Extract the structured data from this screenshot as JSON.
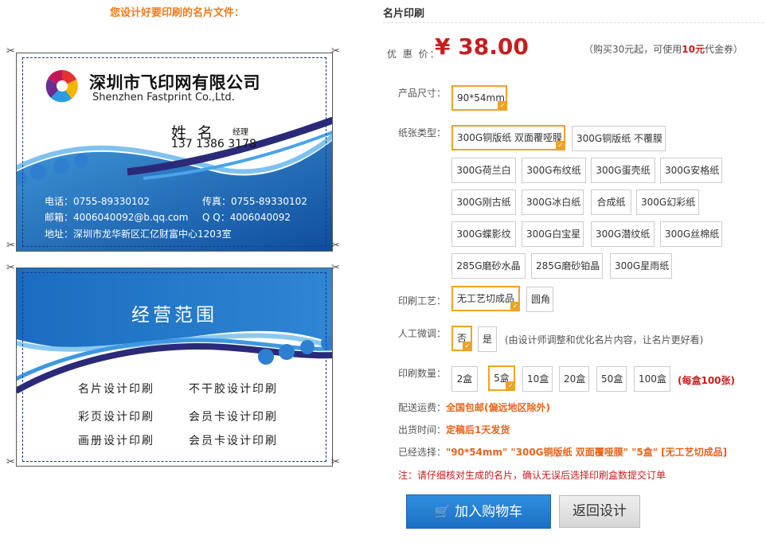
{
  "left": {
    "title": "您设计好要印刷的名片文件："
  },
  "card_front": {
    "company_cn": "深圳市飞印网有限公司",
    "company_en": "Shenzhen Fastprint Co.,Ltd.",
    "name": "姓 名",
    "title": "经理",
    "phone": "137 1386 3178",
    "tel": "电话：0755-89330102",
    "fax": "传真：0755-89330102",
    "email": "邮箱：4006040092@b.qq.com",
    "qq": "Q Q：4006040092",
    "address": "地址：深圳市龙华新区汇亿财富中心1203室"
  },
  "card_back": {
    "title": "经营范围",
    "services": [
      "名片设计印刷",
      "不干胶设计印刷",
      "彩页设计印刷",
      "会员卡设计印刷",
      "画册设计印刷",
      "会员卡设计印刷"
    ]
  },
  "order": {
    "title": "名片印刷",
    "price_label": "优 惠 价：",
    "price": "¥ 38.00",
    "coupon_prefix": "（购买30元起，可使用",
    "coupon_amount": "10元",
    "coupon_suffix": "代金券）",
    "size_label": "产品尺寸：",
    "size_options": [
      "90*54mm"
    ],
    "paper_label": "纸张类型：",
    "paper_options": [
      "300G铜版纸 双面覆哑膜",
      "300G铜版纸 不覆膜",
      "300G荷兰白",
      "300G布纹纸",
      "300G蛋壳纸",
      "300G安格纸",
      "300G刚古纸",
      "300G冰白纸",
      "合成纸",
      "300G幻彩纸",
      "300G蝶影纹",
      "300G白宝星",
      "300G潜纹纸",
      "300G丝棉纸",
      "285G磨砂水晶",
      "285G磨砂铂晶",
      "300G星雨纸"
    ],
    "craft_label": "印刷工艺：",
    "craft_options": [
      "无工艺切成品",
      "圆角"
    ],
    "manual_label": "人工微调：",
    "manual_options": [
      "否",
      "是"
    ],
    "manual_note": "(由设计师调整和优化名片内容，让名片更好看)",
    "qty_label": "印刷数量：",
    "qty_options": [
      "2盒",
      "5盒",
      "10盒",
      "20盒",
      "50盒",
      "100盒"
    ],
    "qty_note": "(每盒100张)",
    "shipping_label": "配送运费：",
    "shipping_value": "全国包邮(偏远地区除外)",
    "delivery_label": "出货时间：",
    "delivery_value": "定稿后1天发货",
    "selected_label": "已经选择：",
    "selected_value": "\"90*54mm\" \"300G铜版纸 双面覆哑膜\" \"5盒\" [无工艺切成品]",
    "warning": "注：请仔细核对生成的名片，确认无误后选择印刷盒数提交订单",
    "add_cart": "加入购物车",
    "back_design": "返回设计"
  },
  "colors": {
    "accent_orange": "#f0a224",
    "price_red": "#c81d1d",
    "card_blue": "#1a68b8",
    "button_blue": "#1c6fc4"
  }
}
